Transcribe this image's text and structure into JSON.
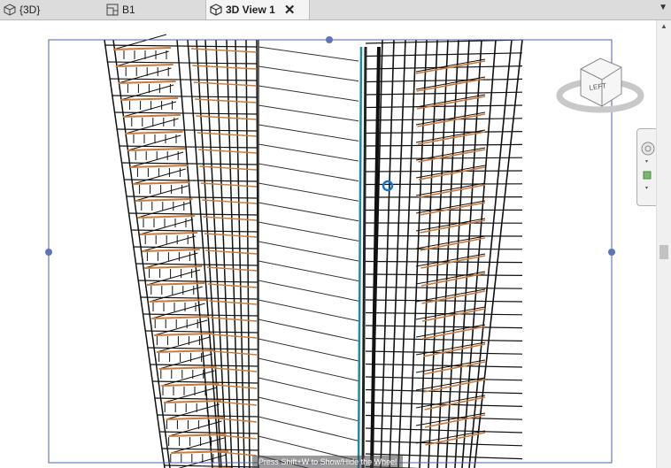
{
  "tabs": [
    {
      "label": "{3D}",
      "icon": "cube-icon"
    },
    {
      "label": "B1",
      "icon": "floor-plan-icon"
    },
    {
      "label": "3D View 1",
      "icon": "cube-icon",
      "active": true
    }
  ],
  "viewcube": {
    "face_label": "LEFT"
  },
  "status_tooltip": "Press Shift+W to Show/Hide the Wheel",
  "colors": {
    "accent_blue": "#1a75c9",
    "section_box": "#4a63a8",
    "framing": "#c87a3a",
    "glass": "#1a8fa0"
  }
}
